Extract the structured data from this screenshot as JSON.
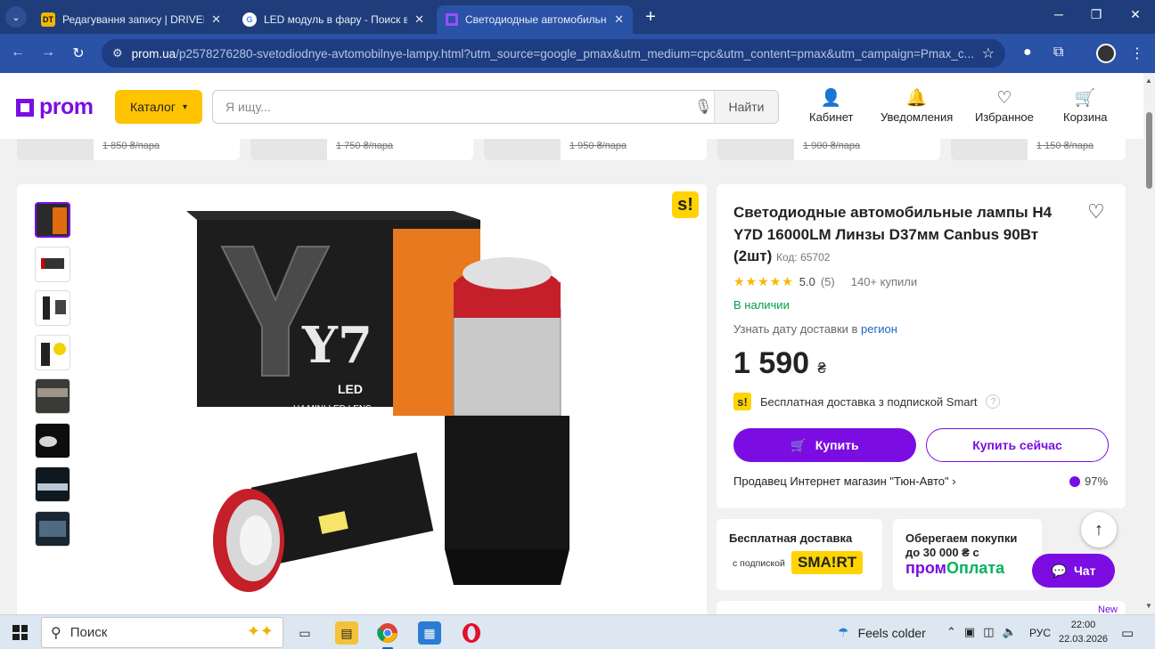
{
  "browser": {
    "tabs": [
      {
        "favicon": "DT",
        "title": "Редагування запису | DRIVER.T",
        "active": false
      },
      {
        "favicon": "G",
        "title": "LED модуль в фару - Поиск в G",
        "active": false
      },
      {
        "favicon": "prom",
        "title": "Светодиодные автомобильные",
        "active": true
      }
    ],
    "url_host": "prom.ua",
    "url_path": "/p2578276280-svetodiodnye-avtomobilnye-lampy.html?utm_source=google_pmax&utm_medium=cpc&utm_content=pmax&utm_campaign=Pmax_c..."
  },
  "header": {
    "logo": "prom",
    "catalog_label": "Каталог",
    "search_placeholder": "Я ищу...",
    "search_button": "Найти",
    "links": [
      "Кабинет",
      "Уведомления",
      "Избранное",
      "Корзина"
    ]
  },
  "strip": {
    "old_prices": [
      "1 850 ₴/пара",
      "1 750 ₴/пара",
      "1 950 ₴/пара",
      "1 900 ₴/пара",
      "1 150 ₴/пара"
    ]
  },
  "gallery": {
    "smart_badge": "s!",
    "thumb_count": 8,
    "box_letters": "Y7",
    "box_sub": "LED",
    "box_caption": "H4 MINI LED LENS"
  },
  "product": {
    "title": "Светодиодные автомобильные лампы H4 Y7D 16000LM Линзы D37мм Canbus 90Вт (2шт)",
    "code": "Код: 65702",
    "rating_value": "5.0",
    "rating_count": "(5)",
    "sold": "140+ купили",
    "stock": "В наличии",
    "delivery_text": "Узнать дату доставки в",
    "delivery_link": "регион",
    "price": "1 590",
    "currency": "₴",
    "smart_text": "Бесплатная доставка з подпиской Smart",
    "buy_label": "Купить",
    "buy_now_label": "Купить сейчас",
    "seller": "Продавец Интернет магазин \"Тюн-Авто\"",
    "seller_rating": "97%"
  },
  "promo": {
    "free_delivery_title": "Бесплатная доставка",
    "free_delivery_sub": "с подпиской",
    "smart_logo": "SMA!RT",
    "protect_title_1": "Оберегаем покупки",
    "protect_title_2": "до 30 000 ₴ с",
    "prom_pay_1": "пром",
    "prom_pay_2": "Оплата"
  },
  "floating": {
    "chat_label": "Чат",
    "new_badge": "New"
  },
  "taskbar": {
    "search_label": "Поиск",
    "weather": "Feels colder",
    "lang": "РУС",
    "time": "22:00",
    "date": "22.03.2026"
  },
  "colors": {
    "brand": "#7b0de3",
    "catalog": "#ffc300",
    "in_stock": "#00a046",
    "browser_tabbar": "#1e3d7a",
    "browser_toolbar": "#2a52a6"
  }
}
